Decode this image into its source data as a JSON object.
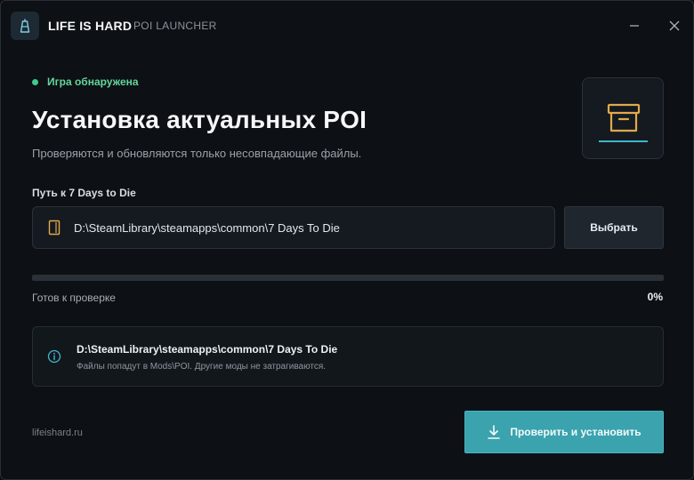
{
  "app": {
    "title": "LIFE IS HARD",
    "separator": "·",
    "subtitle": "POI LAUNCHER",
    "icons": {
      "app": "tower-icon",
      "minimize": "minimize-icon",
      "close": "close-icon"
    }
  },
  "status": {
    "text": "Игра обнаружена",
    "color": "#3fca8c"
  },
  "main": {
    "title": "Установка актуальных POI",
    "description": "Проверяются и обновляются только несовпадающие файлы.",
    "hero_icon": "archive-box-icon"
  },
  "path": {
    "label": "Путь к 7 Days to Die",
    "value": "D:\\SteamLibrary\\steamapps\\common\\7 Days To Die",
    "icon": "folder-icon",
    "browse_label": "Выбрать"
  },
  "progress": {
    "status": "Готов к проверке",
    "percent_text": "0%",
    "value": 0
  },
  "info": {
    "icon": "info-icon",
    "title": "D:\\SteamLibrary\\steamapps\\common\\7 Days To Die",
    "subtitle": "Файлы попадут в Mods\\POI. Другие моды не затрагиваются."
  },
  "footer": {
    "link": "lifeishard.ru"
  },
  "install": {
    "label": "Проверить и установить",
    "icon": "download-icon"
  },
  "colors": {
    "accent": "#3fb6cc",
    "button": "#3aa3ae",
    "status": "#3fca8c",
    "folder": "#e2a94b"
  }
}
